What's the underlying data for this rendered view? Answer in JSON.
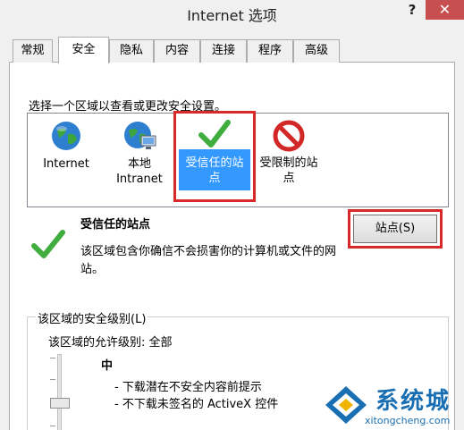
{
  "window": {
    "title": "Internet 选项",
    "help": "?",
    "close": "✕"
  },
  "tabs": [
    {
      "label": "常规"
    },
    {
      "label": "安全"
    },
    {
      "label": "隐私"
    },
    {
      "label": "内容"
    },
    {
      "label": "连接"
    },
    {
      "label": "程序"
    },
    {
      "label": "高级"
    }
  ],
  "active_tab": "安全",
  "security": {
    "instruction": "选择一个区域以查看或更改安全设置。",
    "zones": [
      {
        "line1": "Internet",
        "line2": "",
        "icon": "globe-icon"
      },
      {
        "line1": "本地",
        "line2": "Intranet",
        "icon": "intranet-icon"
      },
      {
        "line1": "受信任的站",
        "line2": "点",
        "icon": "check-icon"
      },
      {
        "line1": "受限制的站",
        "line2": "点",
        "icon": "no-entry-icon"
      }
    ],
    "selected_zone_title": "受信任的站点",
    "selected_zone_desc": "该区域包含你确信不会损害你的计算机或文件的网站。",
    "sites_button": "站点(S)"
  },
  "level_group": {
    "legend": "该区域的安全级别(L)",
    "allowed": "该区域的允许级别: 全部",
    "level_name": "中",
    "bullets": [
      "- 下载潜在不安全内容前提示",
      "- 不下载未签名的 ActiveX 控件"
    ]
  },
  "watermark": {
    "name": "系统城",
    "url": "xitongcheng.com"
  },
  "colors": {
    "selection": "#3399ff",
    "highlight": "#d9292b",
    "close": "#c74f50",
    "check": "#3fae3f"
  }
}
